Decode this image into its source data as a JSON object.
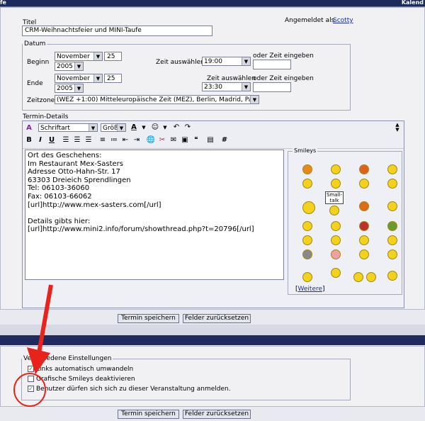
{
  "header": {
    "left": "fe",
    "right": "Kalend"
  },
  "form": {
    "title_label": "Titel",
    "title_value": "CRM-Weihnachtsfeier und MINI-Taufe",
    "logged_in_label": "Angemeldet als",
    "logged_in_user": "Scotty"
  },
  "datum": {
    "legend": "Datum",
    "begin_label": "Beginn",
    "end_label": "Ende",
    "begin_month": "November",
    "begin_day": "25",
    "begin_year": "2005",
    "end_month": "November",
    "end_day": "25",
    "end_year": "2005",
    "zeit_auswaehlen": "Zeit auswählen",
    "begin_time": "19:00",
    "end_time": "23:30",
    "oder_zeit": "oder Zeit eingeben",
    "zeitzone_label": "Zeitzone",
    "zeitzone_value": "(WEZ +1:00) Mitteleuropäische Zeit (MEZ), Berlin, Madrid, Paris"
  },
  "details": {
    "legend": "Termin-Details",
    "font_select": "Schriftart",
    "size_select": "Größe",
    "text": "Ort des Geschehens:\nIm Restaurant Mex-Sasters\nAdresse Otto-Hahn-Str. 17\n63303 Dreieich Sprendlingen\nTel: 06103-36060\nFax: 06103-66062\n[url]http://www.mex-sasters.com[/url]\n\nDetails gibts hier:\n[url]http://www.mini2.info/forum/showthread.php?t=20796[/url]",
    "smileys_legend": "Smileys",
    "sign_text": "Small-talk",
    "more_link": "Weitere",
    "bracket_open": "[",
    "bracket_close": "]"
  },
  "buttons": {
    "save": "Termin speichern",
    "reset": "Felder zurücksetzen"
  },
  "settings": {
    "legend": "Verschiedene Einstellungen",
    "opt1": "Links automatisch umwandeln",
    "opt2": "Grafische Smileys deaktivieren",
    "opt3": "Benutzer dürfen sich sich zu dieser Veranstaltung anmelden.",
    "opt1_checked": true,
    "opt2_checked": false,
    "opt3_checked": true
  },
  "colors": {
    "accent": "#1f2b5e",
    "annotation": "#e8231c"
  }
}
